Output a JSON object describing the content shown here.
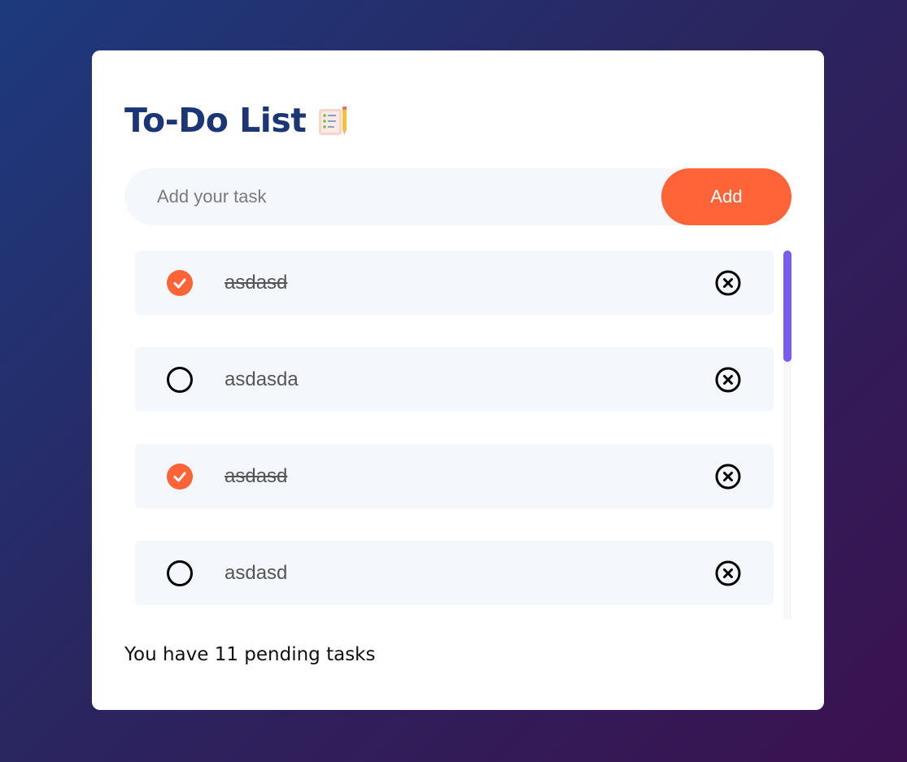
{
  "app": {
    "title": "To-Do List",
    "title_icon": "notepad-pencil-icon"
  },
  "input": {
    "placeholder": "Add your task",
    "value": "",
    "add_label": "Add"
  },
  "tasks": [
    {
      "text": "asdasd",
      "done": true
    },
    {
      "text": "asdasda",
      "done": false
    },
    {
      "text": "asdasd",
      "done": true
    },
    {
      "text": "asdasd",
      "done": false
    }
  ],
  "footer": {
    "text": "You have 11 pending tasks"
  },
  "colors": {
    "accent": "#ff6438",
    "title": "#1b3576",
    "scroll_thumb": "#7b5cf0"
  },
  "icons": {
    "check": "checkmark-icon",
    "delete": "close-circle-icon"
  }
}
